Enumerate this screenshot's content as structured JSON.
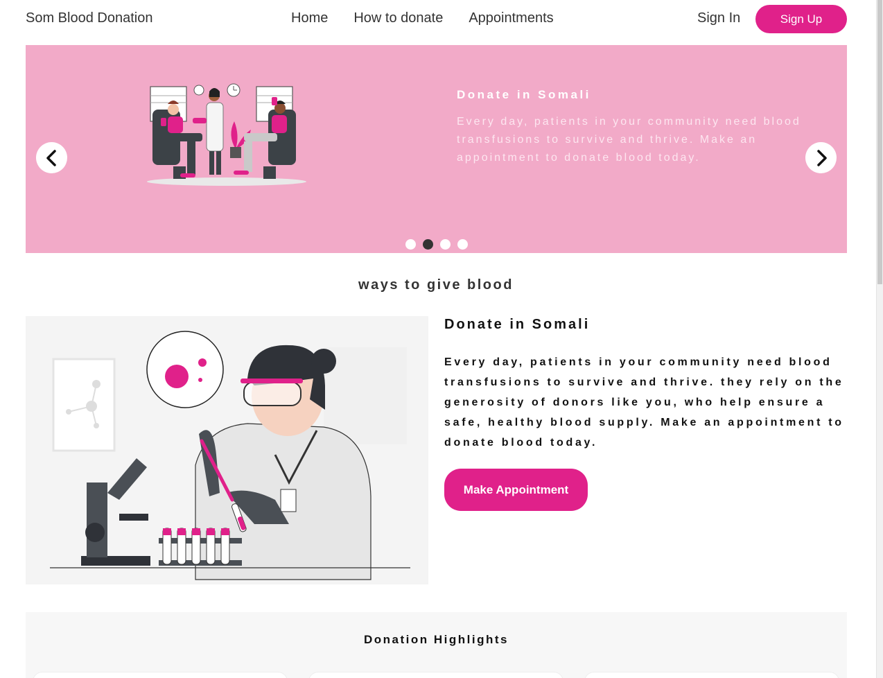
{
  "navbar": {
    "brand": "Som Blood Donation",
    "links": [
      {
        "label": "Home"
      },
      {
        "label": "How to donate"
      },
      {
        "label": "Appointments"
      }
    ],
    "signin_label": "Sign In",
    "signup_label": "Sign Up"
  },
  "carousel": {
    "title": "Donate in Somali",
    "description": "Every day, patients in your community need blood transfusions to survive and thrive. Make an appointment to donate blood today.",
    "prev_icon": "chevron-left-icon",
    "next_icon": "chevron-right-icon",
    "slide_count": 4,
    "active_slide": 2,
    "background": "#f2aac8"
  },
  "ways": {
    "heading": "ways to give blood",
    "title": "Donate in Somali",
    "description": "Every day, patients in your community need blood transfusions to survive and thrive. they rely on the generosity of donors like you, who help ensure a safe, healthy blood supply. Make an appointment to donate blood today.",
    "button_label": "Make Appointment"
  },
  "highlights": {
    "title": "Donation Highlights"
  },
  "colors": {
    "accent": "#e0218a",
    "text": "#222222"
  }
}
